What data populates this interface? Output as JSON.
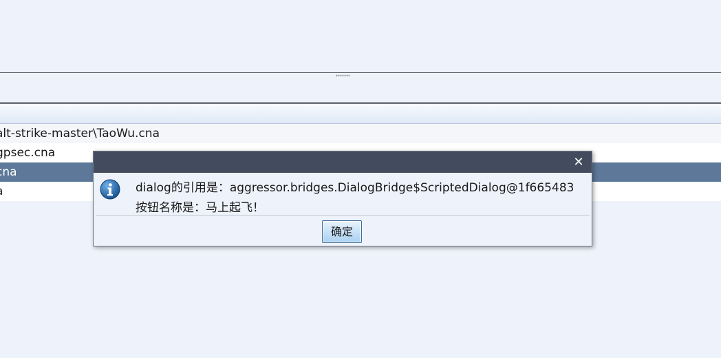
{
  "table": {
    "rows": [
      {
        "text": "alt-strike-master\\TaoWu.cna",
        "state": "normal"
      },
      {
        "text": "gpsec.cna",
        "state": "normal"
      },
      {
        "text": "cna",
        "state": "selected"
      },
      {
        "text": "a",
        "state": "normal"
      }
    ]
  },
  "dialog": {
    "close_symbol": "✕",
    "icon": "info-icon",
    "message_line1": "dialog的引用是：aggressor.bridges.DialogBridge$ScriptedDialog@1f665483",
    "message_line2": "按钮名称是：马上起飞！",
    "ok_label": "确定"
  },
  "colors": {
    "dialog_titlebar": "#434c5e",
    "selected_row": "#5d7898",
    "background": "#eef2fa"
  }
}
